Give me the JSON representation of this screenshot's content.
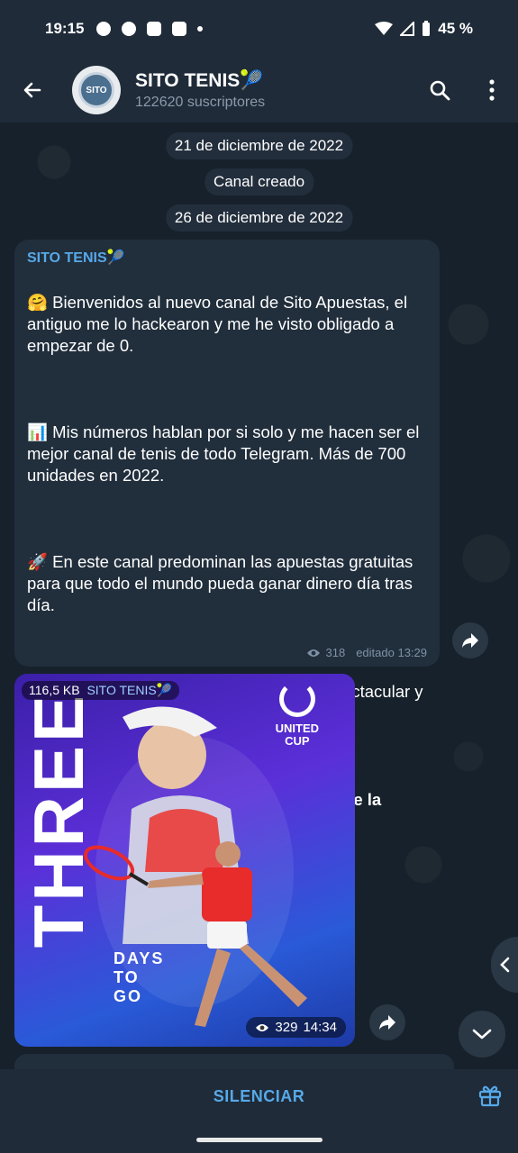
{
  "status_bar": {
    "time": "19:15",
    "battery": "45 %"
  },
  "header": {
    "title": "SITO TENIS🎾",
    "subscribers": "122620 suscriptores",
    "avatar_text": "SITO"
  },
  "chat": {
    "date_1": "21 de diciembre de 2022",
    "service_msg": "Canal creado",
    "date_2": "26 de diciembre de 2022",
    "post": {
      "author": "SITO TENIS🎾",
      "p1": "🤗 Bienvenidos al nuevo canal de Sito Apuestas, el antiguo me lo hackearon y me he visto obligado a empezar de 0.",
      "p2": "📊 Mis números hablan por si solo y me hacen ser el mejor canal de tenis de todo Telegram. Más de 700 unidades en 2022.",
      "p3": "🚀 En este canal predominan las apuestas gratuitas para que todo el mundo pueda ganar dinero día tras día.",
      "p4": "🏆 Estoy seguro de que 2023 va a ser espectacular y vamos a hacer unos números brutales.",
      "p5": "🍾 ¿Estáis preparados para que comience la fiesta?",
      "views": "318",
      "edited": "editado 13:29"
    },
    "media": {
      "size": "116,5 KB",
      "author": "SITO TENIS🎾",
      "big_text": "THREE",
      "sub_text_1": "DAYS",
      "sub_text_2": "TO",
      "sub_text_3": "GO",
      "logo_line_1": "UNITED",
      "logo_line_2": "CUP",
      "views": "329",
      "time": "14:34"
    }
  },
  "bottom_bar": {
    "action": "SILENCIAR"
  },
  "colors": {
    "accent": "#56a9e8",
    "bubble": "#212e3c",
    "header": "#1f2b38"
  }
}
